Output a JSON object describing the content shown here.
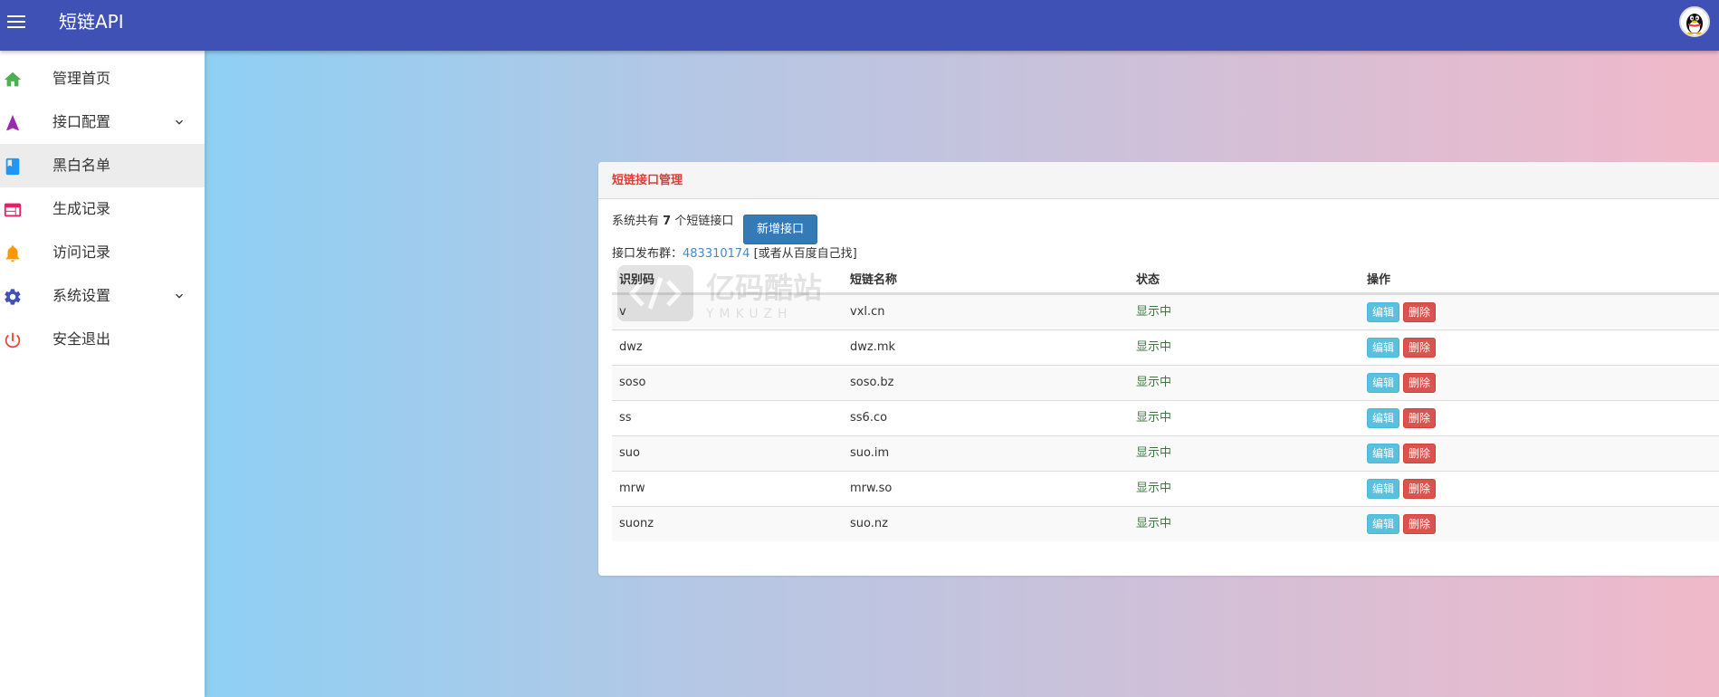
{
  "header": {
    "title": "短链API"
  },
  "sidebar": {
    "items": [
      {
        "label": "管理首页",
        "icon": "home-icon",
        "color": "#4caf50"
      },
      {
        "label": "接口配置",
        "icon": "navigation-arrow-icon",
        "color": "#9c27b0",
        "expandable": true
      },
      {
        "label": "黑白名单",
        "icon": "book-icon",
        "color": "#2196f3",
        "active": true
      },
      {
        "label": "生成记录",
        "icon": "list-icon",
        "color": "#e91e63"
      },
      {
        "label": "访问记录",
        "icon": "bell-icon",
        "color": "#ff9800"
      },
      {
        "label": "系统设置",
        "icon": "gear-icon",
        "color": "#3f51b5",
        "expandable": true
      },
      {
        "label": "安全退出",
        "icon": "power-icon",
        "color": "#f44336"
      }
    ]
  },
  "card": {
    "title": "短链接口管理",
    "summary_prefix": "系统共有 ",
    "summary_count": "7",
    "summary_suffix": " 个短链接口",
    "add_button": "新增接口",
    "group_label": "接口发布群：",
    "group_number": "483310174",
    "group_note": " [或者从百度自己找]"
  },
  "table": {
    "headers": [
      "识别码",
      "短链名称",
      "状态",
      "操作"
    ],
    "edit_label": "编辑",
    "delete_label": "删除",
    "rows": [
      {
        "code": "v",
        "name": "vxl.cn",
        "status": "显示中"
      },
      {
        "code": "dwz",
        "name": "dwz.mk",
        "status": "显示中"
      },
      {
        "code": "soso",
        "name": "soso.bz",
        "status": "显示中"
      },
      {
        "code": "ss",
        "name": "ss6.co",
        "status": "显示中"
      },
      {
        "code": "suo",
        "name": "suo.im",
        "status": "显示中"
      },
      {
        "code": "mrw",
        "name": "mrw.so",
        "status": "显示中"
      },
      {
        "code": "suonz",
        "name": "suo.nz",
        "status": "显示中"
      }
    ]
  },
  "watermark": {
    "text": "亿码酷站",
    "subtext": "YMKUZH"
  },
  "colors": {
    "primary": "#3f51b5",
    "accent_title": "#e53935",
    "status_green": "#3c763d"
  }
}
